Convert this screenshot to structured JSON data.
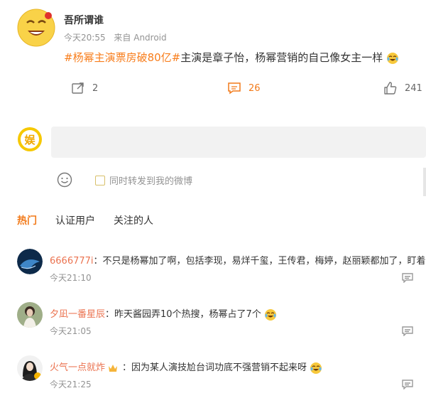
{
  "post": {
    "username": "吾所谓谁",
    "time": "今天20:55",
    "source": "来自 Android",
    "topic": "#杨幂主演票房破80亿#",
    "text": "主演是章子怡，杨幂营销的自己像女主一样",
    "forward_count": "2",
    "comment_count": "26",
    "like_count": "241"
  },
  "composer": {
    "also_forward_label": "同时转发到我的微博"
  },
  "tabs": [
    "热门",
    "认证用户",
    "关注的人"
  ],
  "comments": [
    {
      "name": "6666777i",
      "text": "：不只是杨幂加了啊，包括李现，易烊千玺，王传君，梅婷，赵丽颖都加了，盯着杨",
      "time": "今天21:10"
    },
    {
      "name": "夕凪一番星辰",
      "text": "：昨天酱园弄10个热搜，杨幂占了7个",
      "time": "今天21:05"
    },
    {
      "name": "火气一点就炸",
      "text": "：因为某人演技尬台词功底不强营销不起来呀",
      "time": "今天21:25"
    }
  ],
  "colors": {
    "accent": "#f27a1a",
    "topic": "#f87d1b",
    "comment_name": "#eb7350",
    "muted": "#939393"
  },
  "icons": [
    "laughing-face-avatar",
    "forward-icon",
    "comment-icon",
    "like-icon",
    "entertainment-avatar",
    "smile-icon",
    "laugh-cry-emoji",
    "reply-icon",
    "crown-icon"
  ]
}
